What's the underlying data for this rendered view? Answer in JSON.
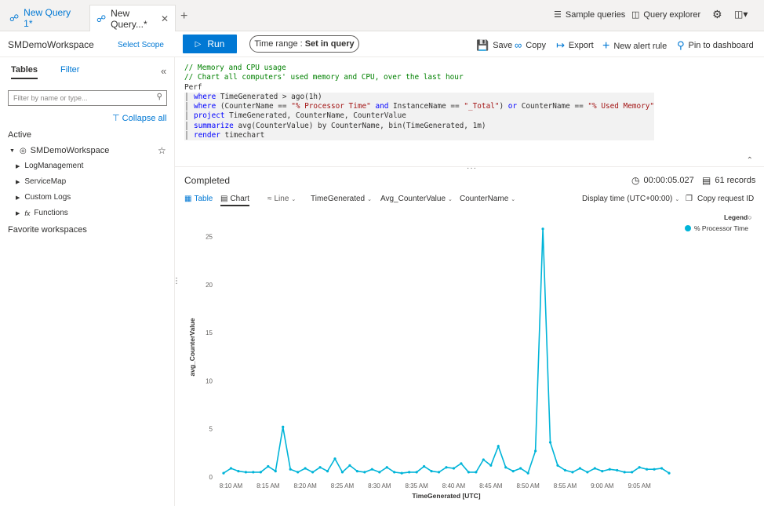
{
  "tabs": {
    "tab1": "New Query 1*",
    "tab2": "New Query...*",
    "add": "+"
  },
  "topbar": {
    "sample_queries": "Sample queries",
    "query_explorer": "Query explorer"
  },
  "workspace": {
    "name": "SMDemoWorkspace",
    "select_scope": "Select Scope"
  },
  "toolbar": {
    "run": "Run",
    "time_range_label": "Time range :",
    "time_range_value": "Set in query",
    "save": "Save",
    "copy": "Copy",
    "export": "Export",
    "new_alert_rule": "New alert rule",
    "pin_to_dashboard": "Pin to dashboard"
  },
  "sidebar": {
    "tab_tables": "Tables",
    "tab_filter": "Filter",
    "filter_placeholder": "Filter by name or type...",
    "collapse_all": "Collapse all",
    "active_label": "Active",
    "workspace_item": "SMDemoWorkspace",
    "items": [
      "LogManagement",
      "ServiceMap",
      "Custom Logs",
      "Functions"
    ],
    "favorites_label": "Favorite workspaces"
  },
  "editor": {
    "lines": [
      {
        "text": "// Memory and CPU usage",
        "kind": "comment"
      },
      {
        "text": "// Chart all computers' used memory and CPU, over the last hour",
        "kind": "comment"
      },
      {
        "text": "Perf",
        "kind": "plain"
      },
      {
        "kw": "where",
        "text": " TimeGenerated > ago(1h)",
        "kind": "pipe"
      },
      {
        "kw": "where",
        "text": " (CounterName == \"% Processor Time\" and InstanceName == \"_Total\") or CounterName == \"% Used Memory\"",
        "kind": "pipe"
      },
      {
        "kw": "project",
        "text": " TimeGenerated, CounterName, CounterValue",
        "kind": "pipe"
      },
      {
        "kw": "summarize",
        "text": " avg(CounterValue) by CounterName, bin(TimeGenerated, 1m)",
        "kind": "pipe"
      },
      {
        "kw": "render",
        "text": " timechart",
        "kind": "pipe"
      }
    ]
  },
  "results": {
    "status": "Completed",
    "elapsed": "00:00:05.027",
    "records": "61 records",
    "view_table": "Table",
    "view_chart": "Chart",
    "chart_type": "Line",
    "x_column": "TimeGenerated",
    "y_column": "Avg_CounterValue",
    "split_column": "CounterName",
    "display_time": "Display time (UTC+00:00)",
    "copy_request_id": "Copy request ID",
    "legend_title": "Legend"
  },
  "chart_data": {
    "type": "line",
    "xlabel": "TimeGenerated [UTC]",
    "ylabel": "avg_CounterValue",
    "ylim": [
      0,
      27
    ],
    "yticks": [
      0,
      5,
      10,
      15,
      20,
      25
    ],
    "xticks": [
      "8:10 AM",
      "8:15 AM",
      "8:20 AM",
      "8:25 AM",
      "8:30 AM",
      "8:35 AM",
      "8:40 AM",
      "8:45 AM",
      "8:50 AM",
      "8:55 AM",
      "9:00 AM",
      "9:05 AM"
    ],
    "x_start": "8:09 AM",
    "x_step_minutes": 1,
    "legend": "top-right",
    "series": [
      {
        "name": "% Processor Time",
        "color": "#00b4d8",
        "values": [
          0.4,
          0.9,
          0.6,
          0.5,
          0.5,
          0.5,
          1.1,
          0.6,
          5.2,
          0.8,
          0.5,
          0.9,
          0.5,
          1.0,
          0.6,
          1.9,
          0.5,
          1.2,
          0.6,
          0.5,
          0.8,
          0.5,
          1.0,
          0.5,
          0.4,
          0.5,
          0.5,
          1.1,
          0.6,
          0.5,
          1.0,
          0.9,
          1.4,
          0.5,
          0.5,
          1.8,
          1.2,
          3.2,
          1.0,
          0.6,
          0.9,
          0.4,
          2.7,
          25.8,
          3.6,
          1.2,
          0.7,
          0.5,
          0.9,
          0.5,
          0.9,
          0.6,
          0.8,
          0.7,
          0.5,
          0.5,
          1.0,
          0.8,
          0.8,
          0.9,
          0.4
        ]
      }
    ]
  }
}
